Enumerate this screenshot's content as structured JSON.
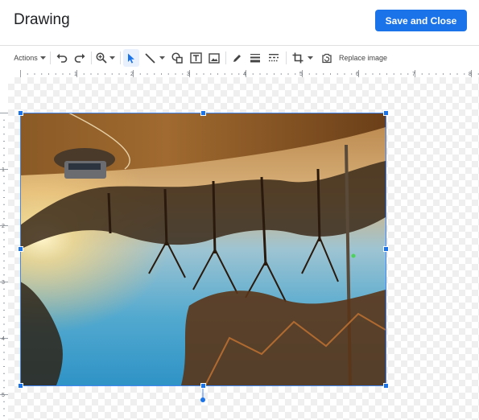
{
  "header": {
    "title": "Drawing",
    "save_label": "Save and Close"
  },
  "toolbar": {
    "actions_label": "Actions",
    "replace_image_label": "Replace image"
  },
  "ruler": {
    "top_marks": [
      "1",
      "2",
      "3",
      "4",
      "5",
      "6",
      "7",
      "8"
    ],
    "left_marks": [
      "1",
      "2",
      "3",
      "4",
      "5"
    ]
  },
  "colors": {
    "accent": "#1a73e8",
    "selection": "#4285f4"
  }
}
